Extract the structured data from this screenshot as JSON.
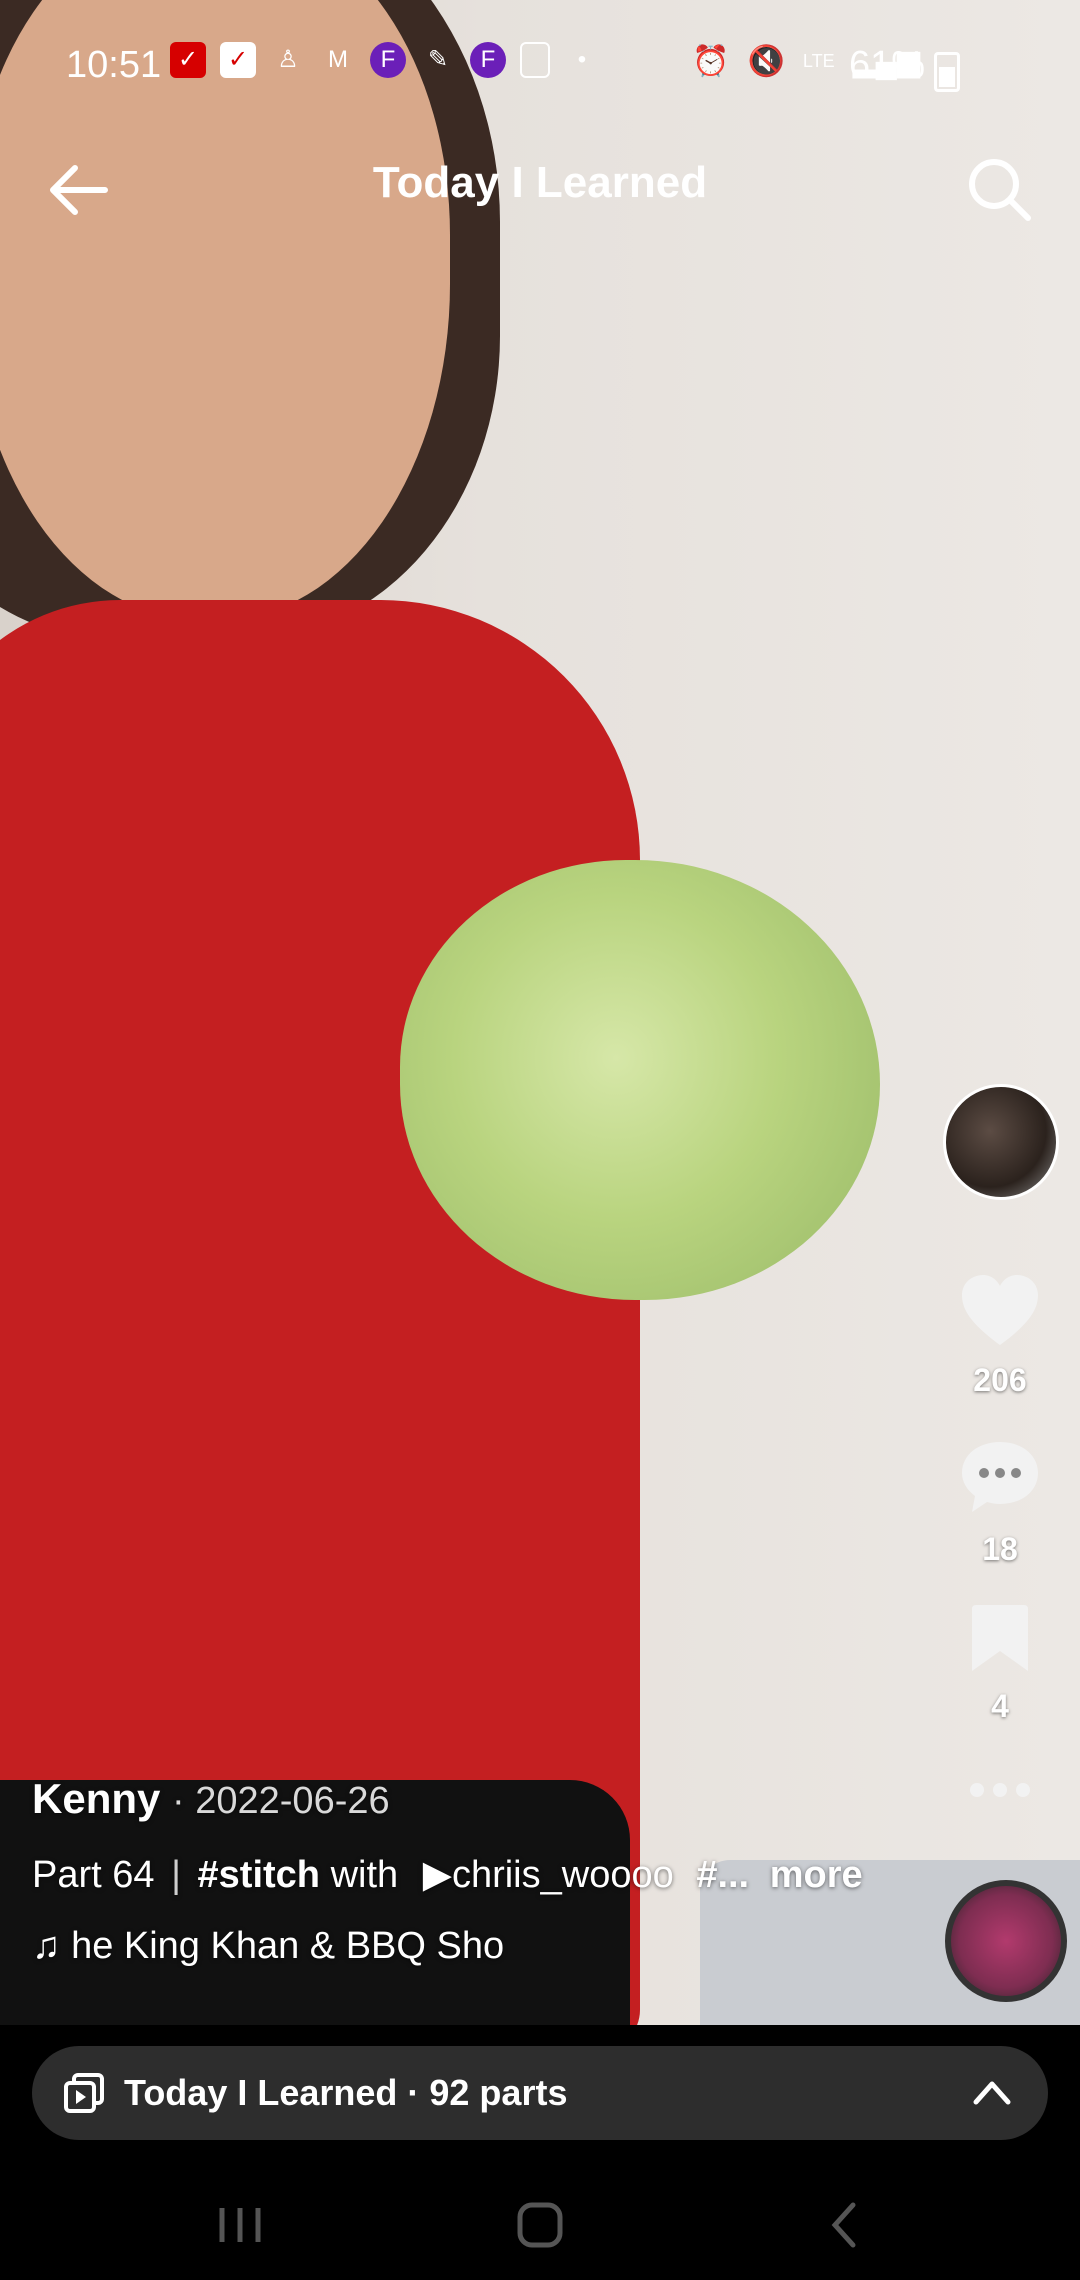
{
  "status_bar": {
    "time": "10:51",
    "battery": "61%"
  },
  "header": {
    "title": "Today I Learned"
  },
  "actions": {
    "likes": "206",
    "comments": "18",
    "saves": "4"
  },
  "caption": {
    "author": "Kenny",
    "date": "· 2022-06-26",
    "part": "Part 64",
    "separator": "|",
    "hashtag": "#stitch",
    "with": "with",
    "stitched_user": "chriis_woooo",
    "hashtag_truncated": "#...",
    "more": "more",
    "music": "he King Khan & BBQ Sho"
  },
  "playlist": {
    "label": "Today I Learned · 92 parts"
  },
  "icons": {
    "back": "back-arrow-icon",
    "search": "search-icon",
    "like": "heart-icon",
    "comment": "comment-icon",
    "save": "bookmark-icon",
    "more": "more-dots-icon",
    "music": "music-note-icon",
    "playlist": "playlist-icon",
    "expand": "chevron-up-icon"
  }
}
